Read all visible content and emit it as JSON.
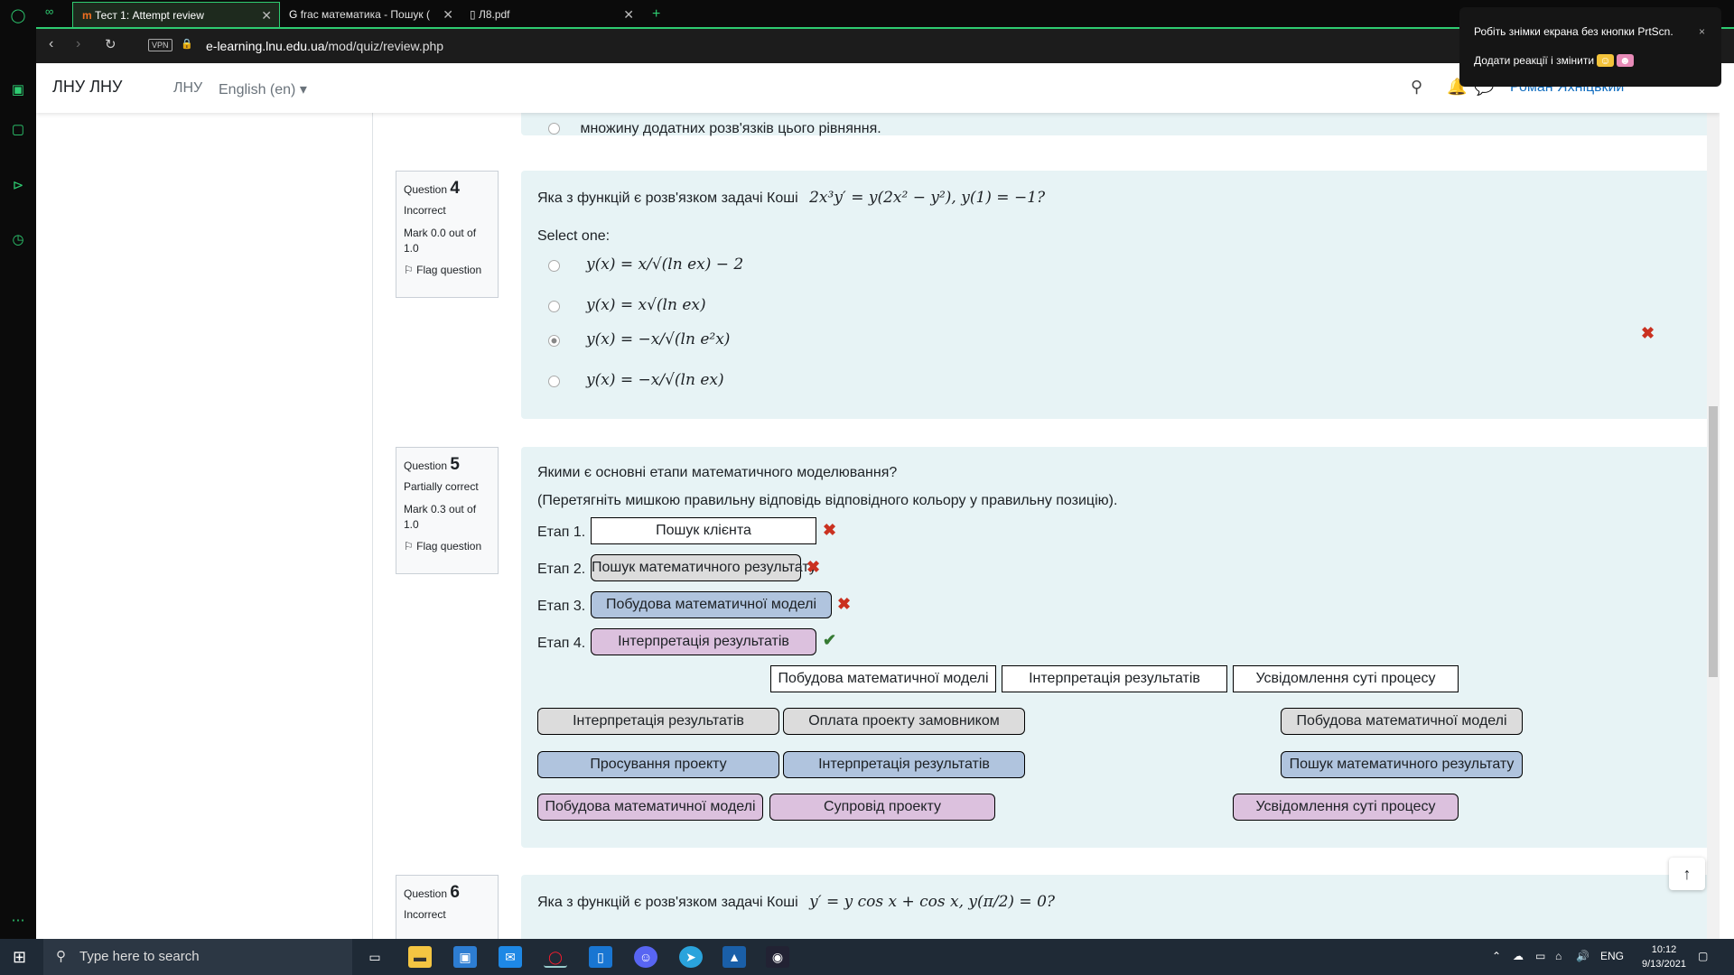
{
  "browser": {
    "tabs": [
      {
        "label": "Тест 1: Attempt review",
        "active": true
      },
      {
        "label": "frac математика - Пошук (",
        "active": false
      },
      {
        "label": "Л8.pdf",
        "active": false
      }
    ],
    "new_tab": "+",
    "vpn": "VPN",
    "url_host": "e-learning.lnu.edu.ua",
    "url_path": "/mod/quiz/review.php"
  },
  "toast": {
    "line1": "Робіть знімки екрана без кнопки PrtScn.",
    "line2": "Додати реакції і змінити",
    "close": "×"
  },
  "moodle_nav": {
    "logo": "ЛНУ ЛНУ",
    "link1": "ЛНУ",
    "language": "English (en)",
    "username": "Роман Яхніцький"
  },
  "partial_top": {
    "text": "множину додатних розв'язків цього рівняння."
  },
  "q4": {
    "label": "Question",
    "number": "4",
    "state": "Incorrect",
    "mark": "Mark 0.0 out of 1.0",
    "flag": "Flag question",
    "text": "Яка з функцій є розв'язком задачі Коші",
    "equation": "2x³y′ = y(2x² − y²),   y(1) = −1?",
    "select_one": "Select one:",
    "answers": [
      "y(x) = x/√(ln ex) − 2",
      "y(x) = x√(ln ex)",
      "y(x) = −x/√(ln e²x)",
      "y(x) = −x/√(ln ex)"
    ],
    "selected_index": 2
  },
  "q5": {
    "label": "Question",
    "number": "5",
    "state": "Partially correct",
    "mark": "Mark 0.3 out of 1.0",
    "flag": "Flag question",
    "text": "Якими є  основні етапи математичного моделювання?",
    "instruction": "(Перетягніть мишкою правильну відповідь відповідного кольору у правильну позицію).",
    "stages": [
      {
        "label": "Етап 1.",
        "answer": "Пошук клієнта",
        "color": "#ffffff",
        "correct": false
      },
      {
        "label": "Етап 2.",
        "answer": "Пошук математичного результату",
        "color": "#dcdcdc",
        "correct": false
      },
      {
        "label": "Етап 3.",
        "answer": "Побудова математичної моделі",
        "color": "#b0c4de",
        "correct": false
      },
      {
        "label": "Етап 4.",
        "answer": "Інтерпретація результатів",
        "color": "#dcc1de",
        "correct": true
      }
    ],
    "choices_white": [
      "Побудова математичної моделі",
      "Інтерпретація результатів",
      "Усвідомлення суті процесу"
    ],
    "choices_grey": [
      "Інтерпретація результатів",
      "Оплата проекту замовником",
      "Побудова математичної моделі"
    ],
    "choices_blue": [
      "Просування проекту",
      "Інтерпретація результатів",
      "Пошук математичного результату"
    ],
    "choices_pink": [
      "Побудова математичної моделі",
      "Супровід проекту",
      "Усвідомлення суті процесу"
    ]
  },
  "q6": {
    "label": "Question",
    "number": "6",
    "state": "Incorrect",
    "text": "Яка з функцій є розв'язком задачі Коші",
    "equation": "y′ = y cos x + cos x,   y(π/2) = 0?"
  },
  "taskbar": {
    "search_placeholder": "Type here to search",
    "lang": "ENG",
    "time": "10:12",
    "date": "9/13/2021"
  }
}
